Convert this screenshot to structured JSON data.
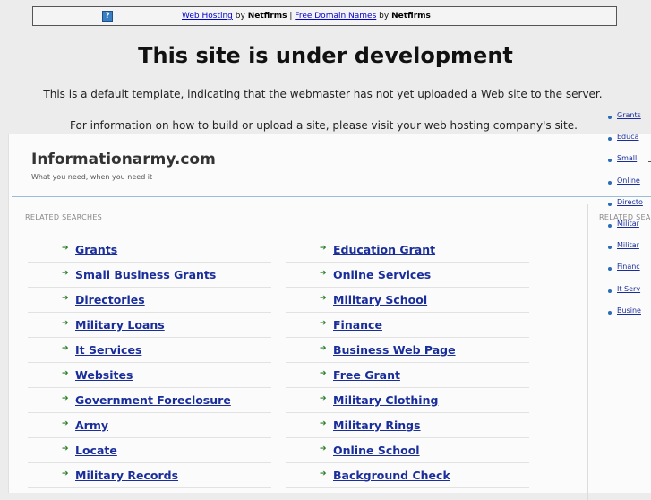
{
  "topbar": {
    "help_icon": "question-icon",
    "web_hosting_link": "Web Hosting",
    "by1": "by",
    "netfirms1": "Netfirms",
    "separator": "|",
    "free_domain_link": "Free Domain Names",
    "by2": "by",
    "netfirms2": "Netfirms"
  },
  "headline": "This site is under development",
  "note1": "This is a default template, indicating that the webmaster has not yet uploaded a Web site to the server.",
  "note2": "For information on how to build or upload a site, please visit your web hosting company's site.",
  "site": {
    "title": "Informationarmy.com",
    "tagline": "What you need, when you need it"
  },
  "related_label": "RELATED SEARCHES",
  "side_label": "RELATED SEA",
  "column1": [
    {
      "label": "Grants"
    },
    {
      "label": "Small Business Grants"
    },
    {
      "label": "Directories"
    },
    {
      "label": "Military Loans"
    },
    {
      "label": "It Services"
    },
    {
      "label": "Websites"
    },
    {
      "label": "Government Foreclosure"
    },
    {
      "label": "Army"
    },
    {
      "label": "Locate"
    },
    {
      "label": "Military Records"
    }
  ],
  "column2": [
    {
      "label": "Education Grant"
    },
    {
      "label": "Online Services"
    },
    {
      "label": "Military School"
    },
    {
      "label": "Finance"
    },
    {
      "label": "Business Web Page"
    },
    {
      "label": "Free Grant"
    },
    {
      "label": "Military Clothing"
    },
    {
      "label": "Military Rings"
    },
    {
      "label": "Online School"
    },
    {
      "label": "Background Check"
    }
  ],
  "side_items": [
    {
      "label": "Grants"
    },
    {
      "label": "Educa"
    },
    {
      "label": "Small"
    },
    {
      "label": "Online"
    },
    {
      "label": "Directo"
    },
    {
      "label": "Militar"
    },
    {
      "label": "Militar"
    },
    {
      "label": "Financ"
    },
    {
      "label": "It Serv"
    },
    {
      "label": "Busine"
    }
  ],
  "colors": {
    "link": "#1a2e9b",
    "arrow": "#2a7d2a",
    "accent_rule": "#9bbbd6"
  }
}
